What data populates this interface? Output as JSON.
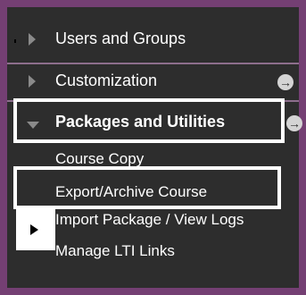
{
  "menu": {
    "items": [
      {
        "label": "Users and Groups"
      },
      {
        "label": "Customization"
      },
      {
        "label": "Packages and Utilities"
      }
    ],
    "subitems": [
      {
        "label": "Course Copy"
      },
      {
        "label": "Export/Archive Course"
      },
      {
        "label": "Import Package / View Logs"
      },
      {
        "label": "Manage LTI Links"
      }
    ]
  },
  "colors": {
    "frame": "#743f73",
    "panel": "#2d2d2d",
    "text": "#ffffff",
    "caret": "#8a8a8a"
  },
  "icons": {
    "collapsed": "caret-right-icon",
    "expanded": "caret-down-icon",
    "go": "circle-arrow-right-icon",
    "flyout": "triangle-right-icon"
  }
}
